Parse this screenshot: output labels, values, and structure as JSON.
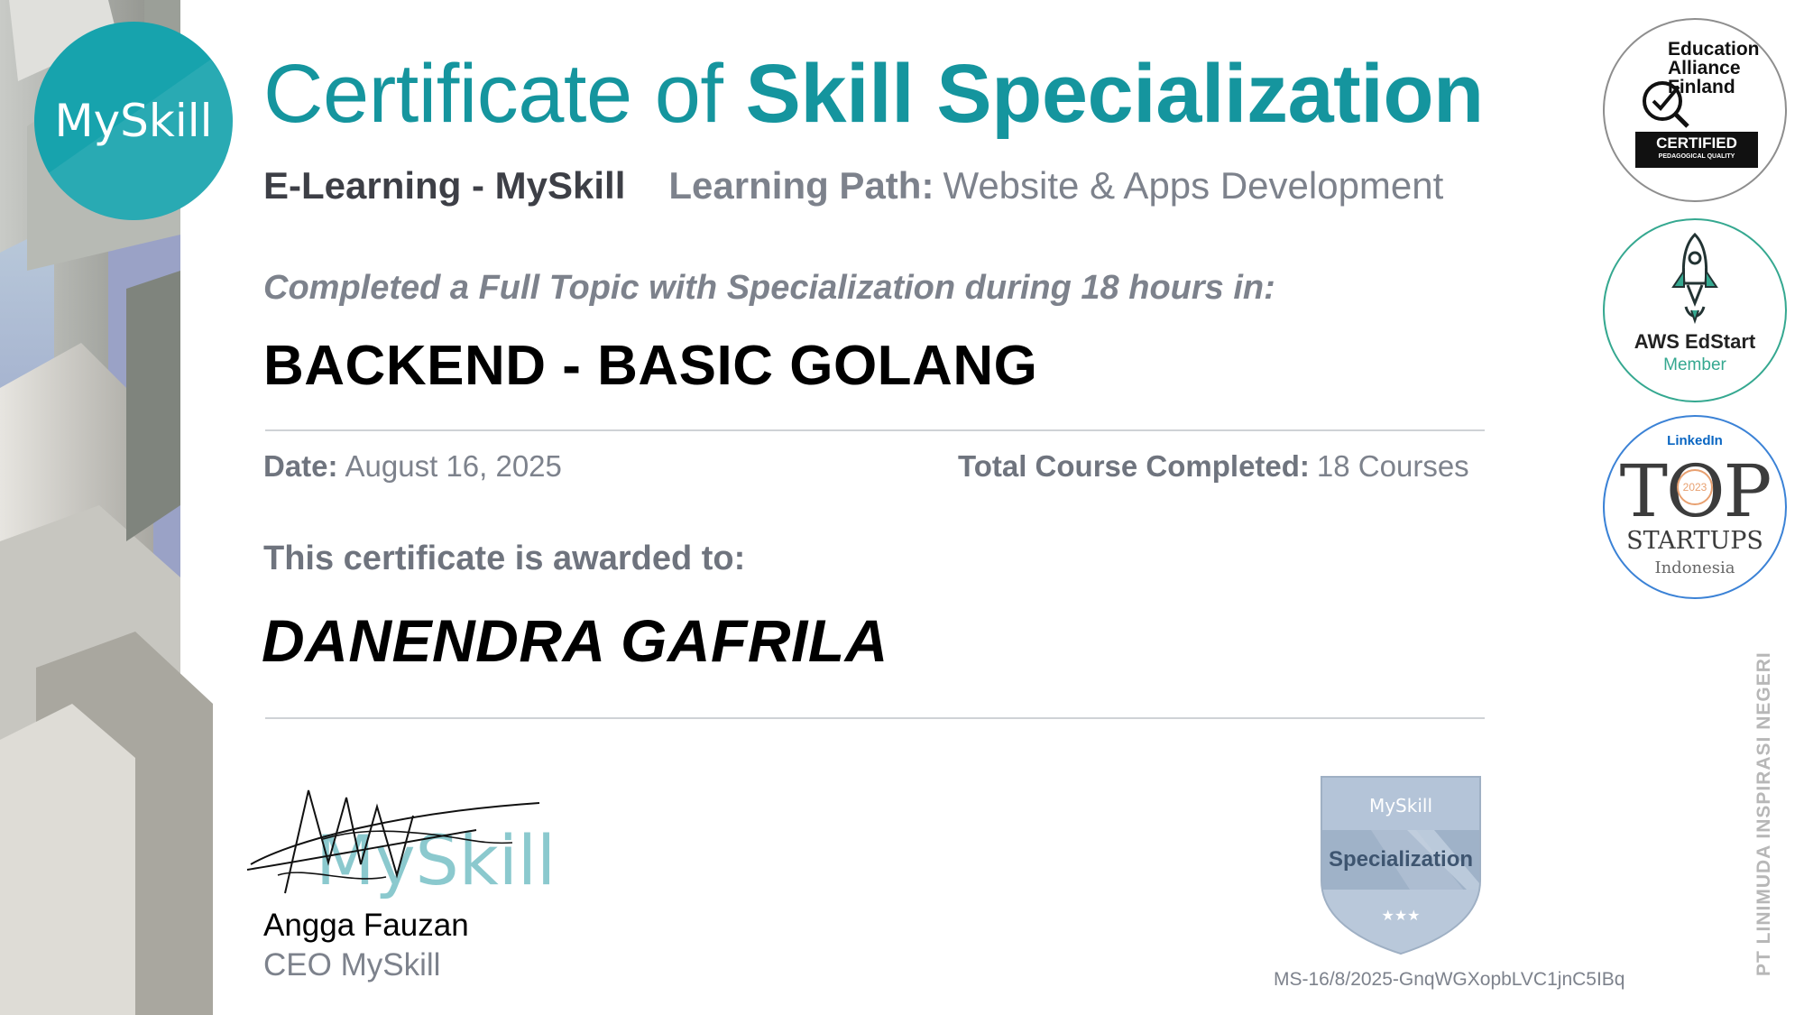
{
  "logo": {
    "text": "MySkill",
    "color": "#17a3ad"
  },
  "title": {
    "light": "Certificate of ",
    "bold": "Skill Specialization",
    "color": "#15959e"
  },
  "subline": {
    "organization": "E-Learning - MySkill",
    "learning_path_label": "Learning Path:",
    "learning_path_value": "Website & Apps Development"
  },
  "completed_text": "Completed a Full Topic with Specialization during 18 hours in:",
  "course_name": "BACKEND - BASIC GOLANG",
  "meta": {
    "date_label": "Date:",
    "date_value": "August 16, 2025",
    "total_label": "Total Course Completed:",
    "total_value": "18 Courses"
  },
  "awarded_text": "This certificate is awarded to:",
  "recipient": "DANENDRA GAFRILA",
  "signature": {
    "mark_text": "MySkill",
    "signer_name": "Angga Fauzan",
    "signer_title": "CEO MySkill"
  },
  "specialization_badge": {
    "brand": "MySkill",
    "label": "Specialization",
    "stars": "★★★"
  },
  "certificate_id": "MS-16/8/2025-GnqWGXopbLVC1jnC5IBq",
  "badges": {
    "eaf": {
      "line1": "Education",
      "line2": "Alliance",
      "line3": "Finland",
      "certified": "CERTIFIED",
      "sub": "PEDAGOGICAL QUALITY"
    },
    "aws": {
      "title": "AWS EdStart",
      "subtitle": "Member"
    },
    "top": {
      "brand": "LinkedIn",
      "word": "TOP",
      "year": "2023",
      "startups": "STARTUPS",
      "country": "Indonesia"
    }
  },
  "company_vertical": "PT LINIMUDA INSPIRASI NEGERI"
}
